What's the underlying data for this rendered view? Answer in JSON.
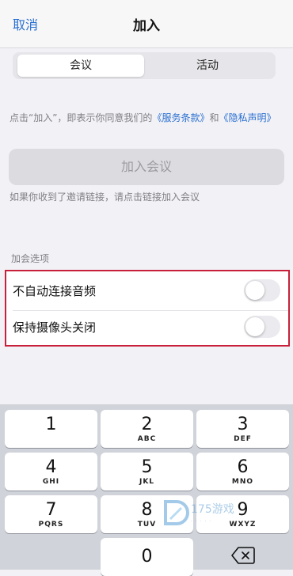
{
  "nav": {
    "cancel": "取消",
    "title": "加入"
  },
  "segments": {
    "meeting": "会议",
    "activity": "活动"
  },
  "terms": {
    "prefix": "点击“加入”，即表示你同意我们的",
    "service_link": "《服务条款》",
    "conjunction": "和",
    "privacy_link": "《隐私声明》"
  },
  "join_button": "加入会议",
  "hint": "如果你收到了邀请链接，请点击链接加入会议",
  "options": {
    "section_label": "加会选项",
    "items": [
      {
        "label": "不自动连接音频",
        "on": false
      },
      {
        "label": "保持摄像头关闭",
        "on": false
      }
    ]
  },
  "keypad": {
    "keys": [
      {
        "num": "1",
        "letters": ""
      },
      {
        "num": "2",
        "letters": "ABC"
      },
      {
        "num": "3",
        "letters": "DEF"
      },
      {
        "num": "4",
        "letters": "GHI"
      },
      {
        "num": "5",
        "letters": "JKL"
      },
      {
        "num": "6",
        "letters": "MNO"
      },
      {
        "num": "7",
        "letters": "PQRS"
      },
      {
        "num": "8",
        "letters": "TUV"
      },
      {
        "num": "9",
        "letters": "WXYZ"
      },
      {
        "num": "0",
        "letters": ""
      }
    ],
    "backspace_icon": "backspace-icon"
  },
  "watermark": {
    "text": "175游戏"
  },
  "colors": {
    "accent": "#2a6fd1",
    "highlight_border": "#c8203a"
  }
}
